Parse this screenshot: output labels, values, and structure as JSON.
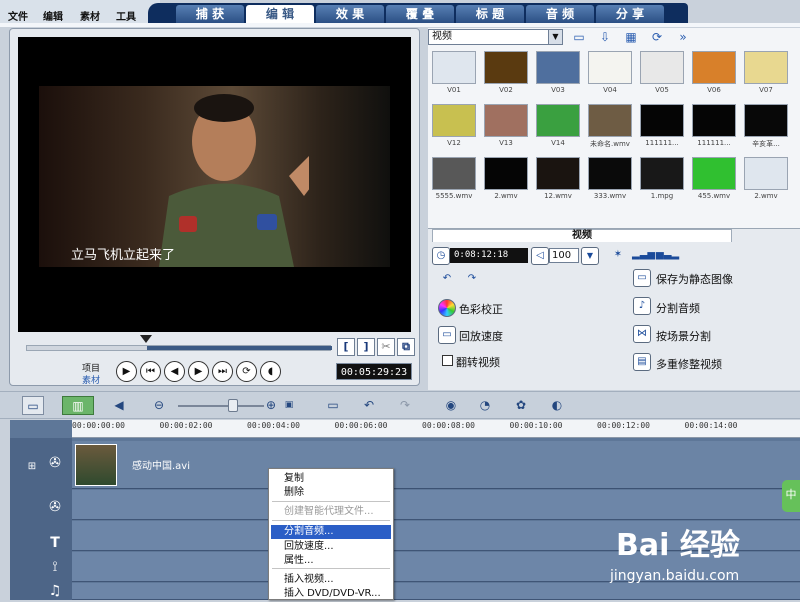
{
  "menu": {
    "items": [
      "文件",
      "编辑",
      "素材",
      "工具"
    ]
  },
  "tabs": [
    {
      "label": "捕 获",
      "active": false
    },
    {
      "label": "编 辑",
      "active": true
    },
    {
      "label": "效 果",
      "active": false
    },
    {
      "label": "覆 叠",
      "active": false
    },
    {
      "label": "标 题",
      "active": false
    },
    {
      "label": "音 频",
      "active": false
    },
    {
      "label": "分 享",
      "active": false
    }
  ],
  "preview": {
    "subtitle": "立马飞机立起来了",
    "project_label": "项目",
    "clip_label": "素材",
    "mark_in": "[",
    "mark_out": "]",
    "timecode": "00:05:29:23"
  },
  "library": {
    "category": "视频",
    "thumbnails": [
      {
        "label": "V01",
        "color": "#dfe6ee"
      },
      {
        "label": "V02",
        "color": "#5a3a10"
      },
      {
        "label": "V03",
        "color": "#4f6f9e"
      },
      {
        "label": "V04",
        "color": "#f4f4f0"
      },
      {
        "label": "V05",
        "color": "#e8e8e8"
      },
      {
        "label": "V06",
        "color": "#d8802a"
      },
      {
        "label": "V07",
        "color": "#e8d890"
      },
      {
        "label": "V12",
        "color": "#c8c050"
      },
      {
        "label": "V13",
        "color": "#a07060"
      },
      {
        "label": "V14",
        "color": "#3aa040"
      },
      {
        "label": "未命名.wmv",
        "color": "#6e5c44"
      },
      {
        "label": "111111...",
        "color": "#050505"
      },
      {
        "label": "111111...",
        "color": "#050505"
      },
      {
        "label": "辛亥革...",
        "color": "#080808"
      },
      {
        "label": "5555.wmv",
        "color": "#585858"
      },
      {
        "label": "2.wmv",
        "color": "#050505"
      },
      {
        "label": "12.wmv",
        "color": "#1a1410"
      },
      {
        "label": "333.wmv",
        "color": "#0a0a0a"
      },
      {
        "label": "1.mpg",
        "color": "#181818"
      },
      {
        "label": "455.wmv",
        "color": "#30c030"
      },
      {
        "label": "2.wmv",
        "color": "#dfe6ee"
      }
    ]
  },
  "options": {
    "tab_label": "视频",
    "duration": "0:08:12:18",
    "volume": "100",
    "left": [
      "色彩校正",
      "回放速度",
      "翻转视频"
    ],
    "right": [
      "保存为静态图像",
      "分割音频",
      "按场景分割",
      "多重修整视频"
    ]
  },
  "ruler": [
    "00:00:00:00",
    "00:00:02:00",
    "00:00:04:00",
    "00:00:06:00",
    "00:00:08:00",
    "00:00:10:00",
    "00:00:12:00",
    "00:00:14:00"
  ],
  "timeline": {
    "clip_name": "感动中国.avi",
    "side_tag": "中"
  },
  "context_menu": {
    "items": [
      {
        "label": "复制",
        "state": "normal"
      },
      {
        "label": "删除",
        "state": "normal"
      },
      {
        "label": "创建智能代理文件...",
        "state": "disabled"
      },
      {
        "label": "分割音频...",
        "state": "highlighted"
      },
      {
        "label": "回放速度...",
        "state": "normal"
      },
      {
        "label": "属性...",
        "state": "normal"
      },
      {
        "label": "插入视频...",
        "state": "normal"
      },
      {
        "label": "插入 DVD/DVD-VR...",
        "state": "normal"
      }
    ]
  },
  "watermark": {
    "logo": "Bai 经验",
    "url": "jingyan.baidu.com"
  },
  "colors": {
    "highlight": "#2b5ec6",
    "tab_dark": "#0e2d5e",
    "timeline_bg": "#5e7798"
  }
}
